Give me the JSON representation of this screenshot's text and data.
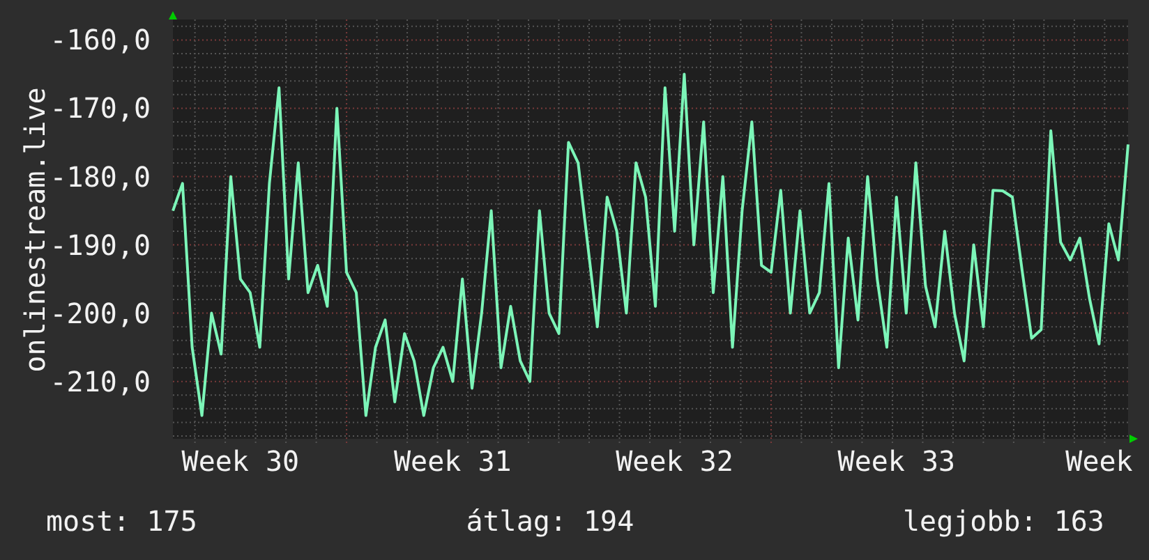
{
  "graph": {
    "chart_data": {
      "type": "line",
      "ylabel": "onlinestream.live",
      "grid": true,
      "ylim": [
        -218.4,
        -157
      ],
      "yticks": [
        {
          "value": -160,
          "label": "-160,0"
        },
        {
          "value": -170,
          "label": "-170,0"
        },
        {
          "value": -180,
          "label": "-180,0"
        },
        {
          "value": -190,
          "label": "-190,0"
        },
        {
          "value": -200,
          "label": "-200,0"
        },
        {
          "value": -210,
          "label": "-210,0"
        }
      ],
      "categories": [
        null,
        null,
        null,
        null,
        null,
        null,
        null,
        "Week 30",
        null,
        null,
        null,
        null,
        null,
        null,
        null,
        null,
        null,
        null,
        null,
        null,
        null,
        null,
        null,
        null,
        null,
        null,
        null,
        null,
        null,
        "Week 31",
        null,
        null,
        null,
        null,
        null,
        null,
        null,
        null,
        null,
        null,
        null,
        null,
        null,
        null,
        null,
        null,
        null,
        null,
        null,
        null,
        null,
        null,
        "Week 32",
        null,
        null,
        null,
        null,
        null,
        null,
        null,
        null,
        null,
        null,
        null,
        null,
        null,
        null,
        null,
        null,
        null,
        null,
        null,
        null,
        null,
        null,
        "Week 33",
        null,
        null,
        null,
        null,
        null,
        null,
        null,
        null,
        null,
        null,
        null,
        null,
        null,
        null,
        null,
        null,
        null,
        null,
        null,
        null,
        "Week",
        null,
        null,
        null
      ],
      "series": [
        {
          "color": "#7cf5b8",
          "values": [
            -185,
            -181,
            -205,
            -215,
            -200,
            -206,
            -180,
            -195,
            -197,
            -205,
            -181,
            -167,
            -195,
            -178,
            -197,
            -193,
            -199,
            -170,
            -194,
            -197,
            -215,
            -205,
            -201,
            -213,
            -203,
            -207,
            -215,
            -208,
            -205,
            -210,
            -195,
            -211,
            -200,
            -185,
            -208,
            -199,
            -207,
            -210,
            -185,
            -200,
            -203,
            -175,
            -178,
            -190,
            -202,
            -183,
            -188,
            -200,
            -178,
            -183,
            -199,
            -167,
            -188,
            -165,
            -190,
            -172,
            -197,
            -180,
            -205,
            -185,
            -172,
            -193,
            -194,
            -182,
            -200,
            -185,
            -200,
            -197,
            -181,
            -208,
            -189,
            -201,
            -180,
            -195,
            -205,
            -183,
            -200,
            -178,
            -196,
            -202,
            -188,
            -200,
            -207,
            -190,
            -202,
            -182,
            -182.1,
            -183,
            -193.6,
            -203.7,
            -202.4,
            -173.3,
            -189.6,
            -192.2,
            -189,
            -197.8,
            -204.5,
            -186.9,
            -192.2,
            -175.3
          ]
        }
      ]
    }
  },
  "stats": [
    "most: 175",
    "átlag: 194",
    "legjobb: 163"
  ]
}
